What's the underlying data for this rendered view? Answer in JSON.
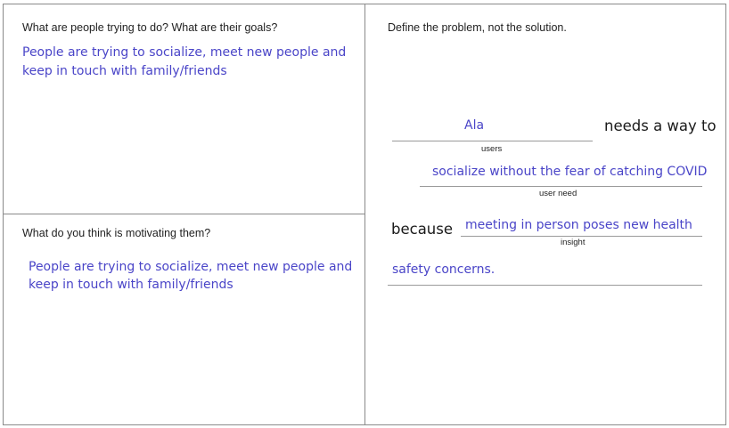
{
  "top_left": {
    "question": "What are people trying to do? What are their goals?",
    "answer_line1": "People are trying to socialize, meet new people and",
    "answer_line2": "keep in touch with family/friends"
  },
  "bottom_left": {
    "question": "What do you think is motivating them?",
    "answer_line1": "People are trying to socialize, meet new people and",
    "answer_line2": "keep in touch with family/friends"
  },
  "right": {
    "heading": "Define the problem, not the solution.",
    "users_value": "Ala",
    "users_caption": "users",
    "needs_text": "needs a way to",
    "user_need_value": "socialize without the fear of catching COVID",
    "user_need_caption": "user need",
    "because_text": "because",
    "insight_value": "meeting in person poses new health",
    "insight_caption": "insight",
    "insight_continued": "safety concerns."
  }
}
